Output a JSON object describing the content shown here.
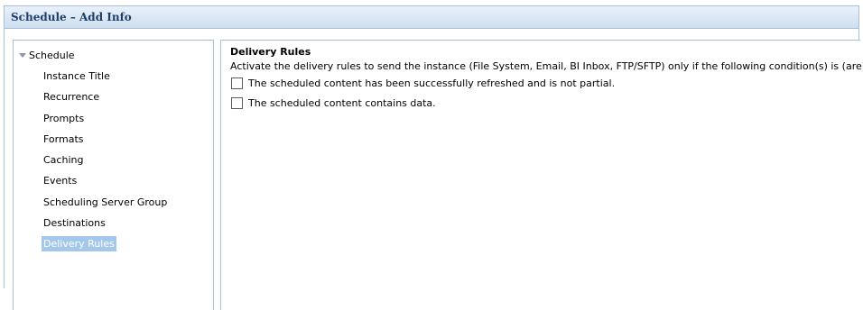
{
  "window": {
    "title": "Schedule – Add Info"
  },
  "nav": {
    "root_label": "Schedule",
    "items": [
      {
        "label": "Instance Title",
        "selected": false
      },
      {
        "label": "Recurrence",
        "selected": false
      },
      {
        "label": "Prompts",
        "selected": false
      },
      {
        "label": "Formats",
        "selected": false
      },
      {
        "label": "Caching",
        "selected": false
      },
      {
        "label": "Events",
        "selected": false
      },
      {
        "label": "Scheduling Server Group",
        "selected": false
      },
      {
        "label": "Destinations",
        "selected": false
      },
      {
        "label": "Delivery Rules",
        "selected": true
      }
    ]
  },
  "content": {
    "title": "Delivery Rules",
    "description": "Activate the delivery rules to send the instance (File System, Email, BI Inbox, FTP/SFTP) only if the following condition(s) is (are) met:",
    "rules": [
      {
        "label": "The scheduled content has been successfully refreshed and is not partial.",
        "checked": false
      },
      {
        "label": "The scheduled content contains data.",
        "checked": false
      }
    ]
  },
  "colors": {
    "title_text": "#1d3f6b",
    "border": "#a9bfd6",
    "selection": "#a3c8ec"
  }
}
